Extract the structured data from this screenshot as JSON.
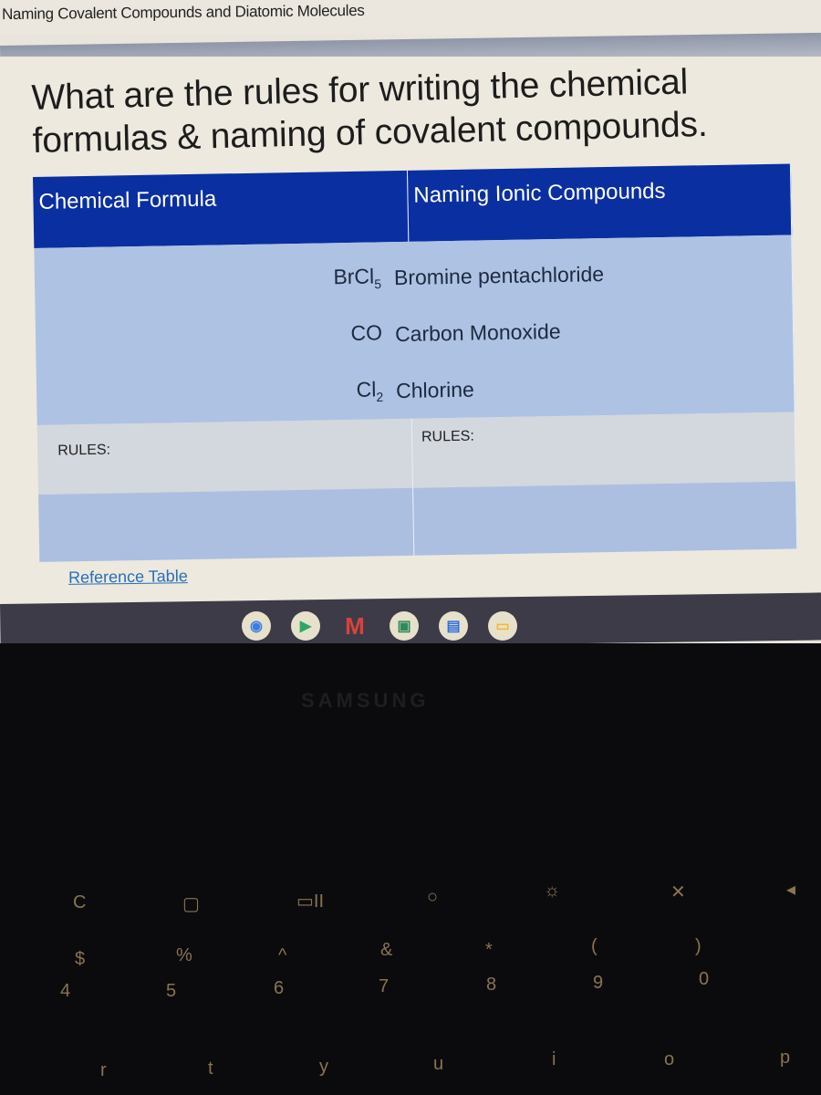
{
  "topbar": {
    "doc_title": "Naming Covalent Compounds and Diatomic Molecules"
  },
  "page": {
    "heading": "What are the rules for writing the chemical formulas & naming of covalent compounds.",
    "table": {
      "headers": [
        "Chemical Formula",
        "Naming Ionic Compounds"
      ],
      "examples": [
        {
          "formula": "BrCl",
          "subscript": "5",
          "name": "Bromine pentachloride"
        },
        {
          "formula": "CO",
          "subscript": "",
          "name": "Carbon Monoxide"
        },
        {
          "formula": "Cl",
          "subscript": "2",
          "name": "Chlorine"
        }
      ],
      "rules_left": "RULES:",
      "rules_right": "RULES:"
    },
    "reference_link": "Reference Table"
  },
  "shelf": {
    "apps": [
      {
        "name": "chrome",
        "glyph": "◉",
        "color": "#3b7de0"
      },
      {
        "name": "play-store",
        "glyph": "▶",
        "color": "#2ca866"
      },
      {
        "name": "gmail",
        "glyph": "M",
        "color": "#d9433a"
      },
      {
        "name": "classroom",
        "glyph": "▣",
        "color": "#2e8b57"
      },
      {
        "name": "docs",
        "glyph": "▤",
        "color": "#2f6fe0"
      },
      {
        "name": "slides",
        "glyph": "▭",
        "color": "#f2b928"
      }
    ]
  },
  "bezel": {
    "brand": "SAMSUNG"
  },
  "keyboard": {
    "function_row": [
      "C",
      "▢",
      "▭II",
      "○",
      "☼",
      "✕",
      "◂"
    ],
    "symbol_row": [
      "$",
      "%",
      "^",
      "&",
      "*",
      "(",
      ")"
    ],
    "number_row": [
      "4",
      "5",
      "6",
      "7",
      "8",
      "9",
      "0"
    ],
    "letter_row": [
      "r",
      "t",
      "y",
      "u",
      "i",
      "o",
      "p"
    ]
  }
}
